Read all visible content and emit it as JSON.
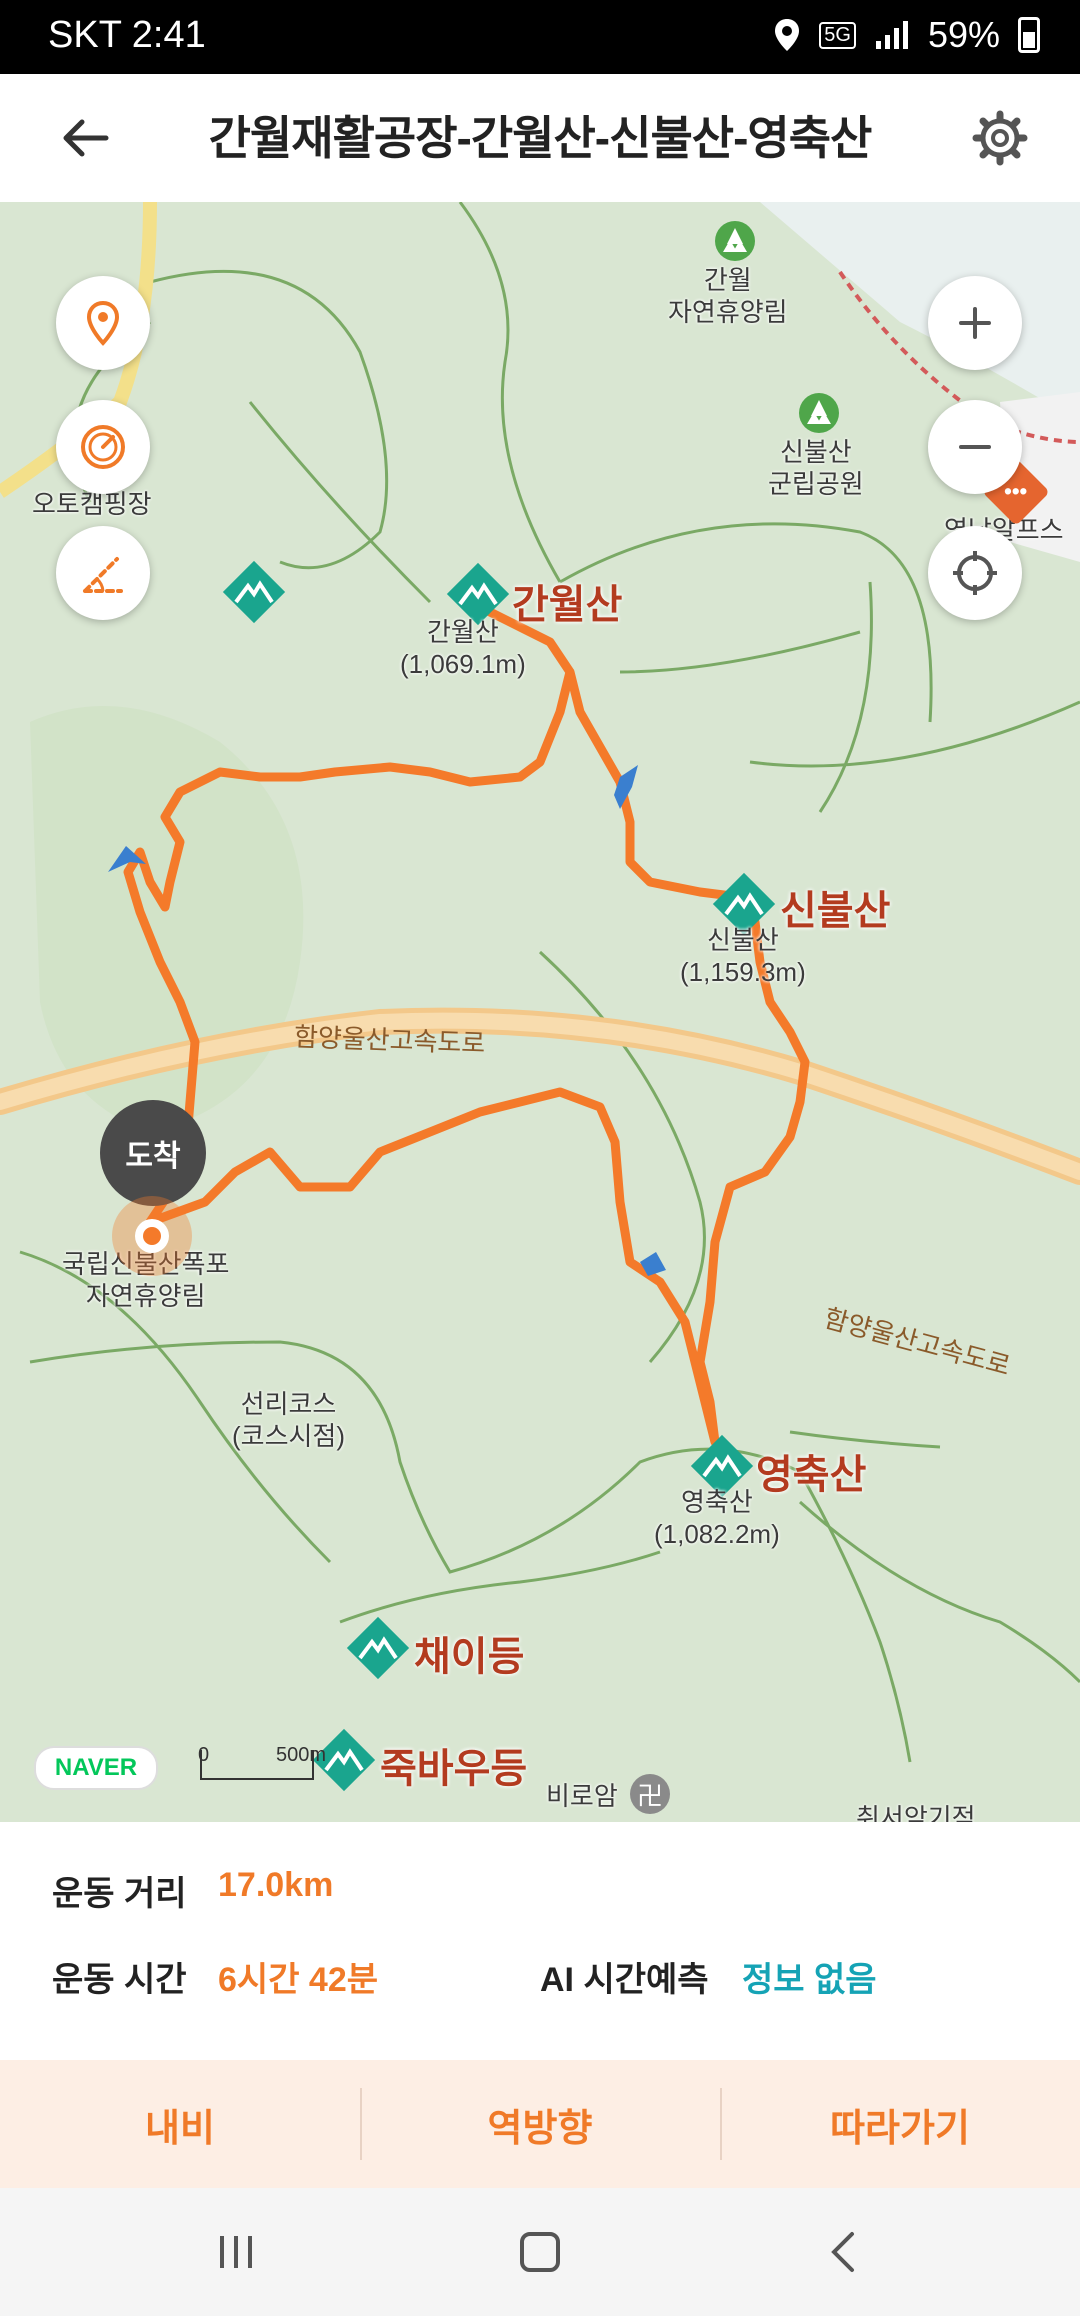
{
  "status_bar": {
    "carrier_time": "SKT 2:41",
    "network": "5G",
    "battery": "59%"
  },
  "header": {
    "title": "간월재활공장-간월산-신불산-영축산"
  },
  "map": {
    "peaks": [
      {
        "name": "간월산",
        "sub": "간월산",
        "alt": "(1,069.1m)"
      },
      {
        "name": "신불산",
        "sub": "신불산",
        "alt": "(1,159.3m)"
      },
      {
        "name": "영축산",
        "sub": "영축산",
        "alt": "(1,082.2m)"
      },
      {
        "name": "채이등"
      },
      {
        "name": "죽바우등"
      }
    ],
    "places": {
      "ganwol_forest": "간월\n자연휴양림",
      "sinbul_park": "신불산\n군립공원",
      "auto_camping": "오토캠핑장",
      "waterfall_forest": "국립신불산폭포\n자연휴양림",
      "sunri_course": "선리코스\n(코스시점)",
      "biroam": "비로암",
      "alps": "영남알프스",
      "chiseo": "취서암기적"
    },
    "road_name": "함양울산고속도로",
    "arrival": "도착",
    "naver": "NAVER",
    "scale": {
      "zero": "0",
      "distance": "500m"
    }
  },
  "stats": {
    "distance_label": "운동 거리",
    "distance_value": "17.0km",
    "time_label": "운동 시간",
    "time_value": "6시간 42분",
    "ai_label": "AI 시간예측",
    "ai_value": "정보 없음"
  },
  "actions": {
    "navi": "내비",
    "reverse": "역방향",
    "follow": "따라가기"
  },
  "colors": {
    "route": "#f47a2a",
    "accent": "#f07a28",
    "teal": "#15a3b5",
    "map_bg": "#d9e6d2"
  }
}
